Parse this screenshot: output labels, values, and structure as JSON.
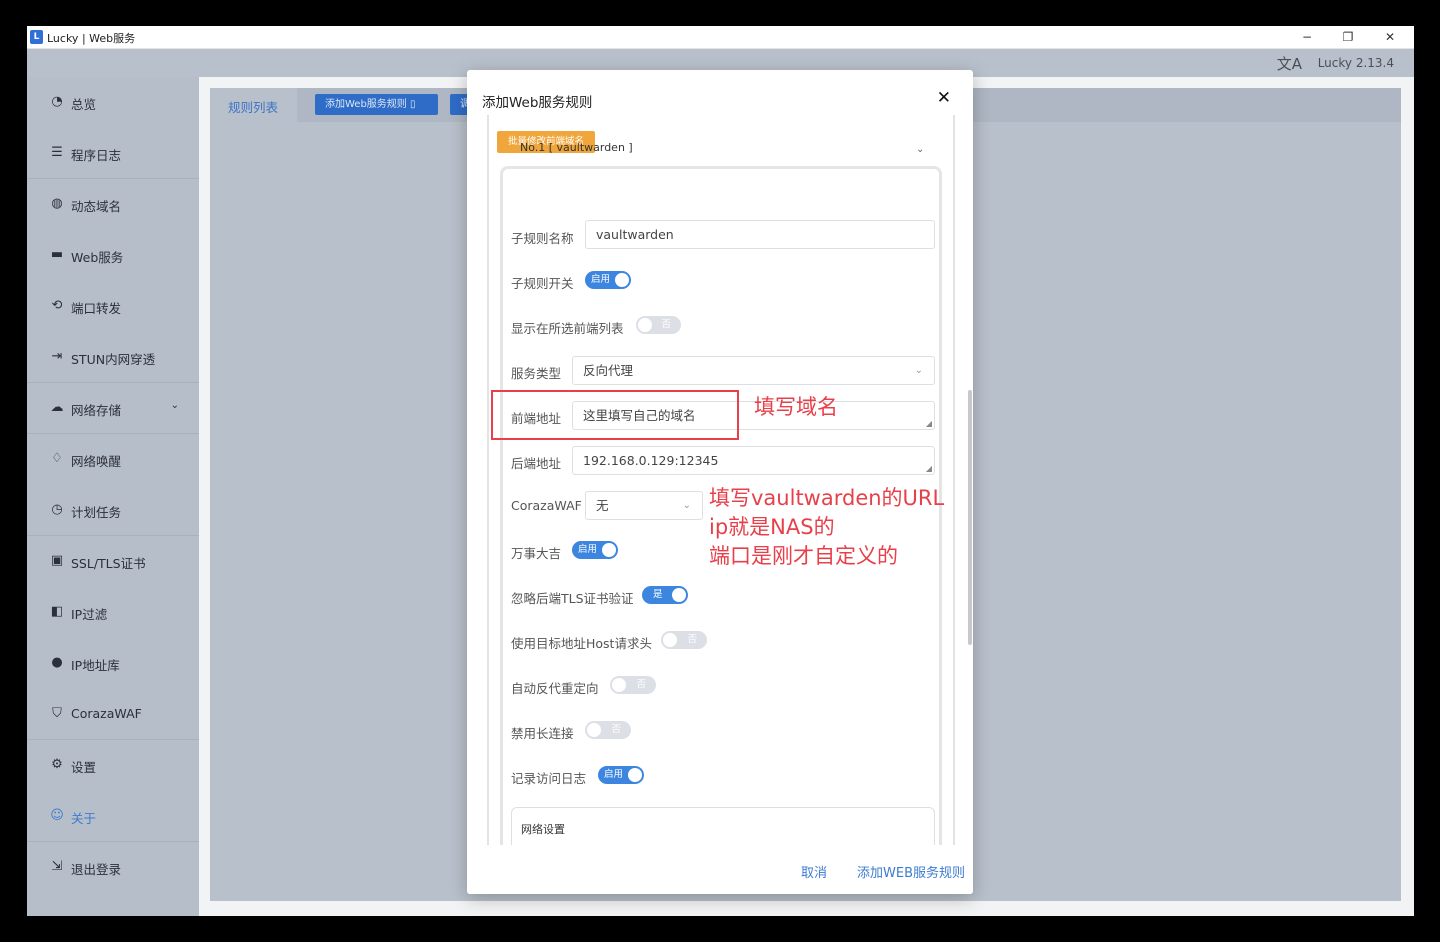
{
  "window": {
    "title": "Lucky | Web服务",
    "minimize": "−",
    "maximize": "❐",
    "close": "✕"
  },
  "topbar": {
    "version": "Lucky 2.13.4"
  },
  "sidebar": {
    "items": [
      {
        "label": "总览",
        "icon": "dashboard-icon"
      },
      {
        "label": "程序日志",
        "icon": "log-icon"
      },
      {
        "label": "动态域名",
        "icon": "ddns-icon"
      },
      {
        "label": "Web服务",
        "icon": "web-icon"
      },
      {
        "label": "端口转发",
        "icon": "port-forward-icon"
      },
      {
        "label": "STUN内网穿透",
        "icon": "stun-icon"
      },
      {
        "label": "网络存储",
        "icon": "cloud-icon"
      },
      {
        "label": "网络唤醒",
        "icon": "bell-icon"
      },
      {
        "label": "计划任务",
        "icon": "clock-icon"
      },
      {
        "label": "SSL/TLS证书",
        "icon": "certificate-icon"
      },
      {
        "label": "IP过滤",
        "icon": "ip-filter-icon"
      },
      {
        "label": "IP地址库",
        "icon": "user-icon"
      },
      {
        "label": "CorazaWAF",
        "icon": "shield-icon"
      },
      {
        "label": "设置",
        "icon": "gear-icon"
      },
      {
        "label": "关于",
        "icon": "about-icon"
      },
      {
        "label": "退出登录",
        "icon": "logout-icon"
      }
    ]
  },
  "main": {
    "tab_rules": "规则列表",
    "add_rule_button": "添加Web服务规则",
    "second_button": "调"
  },
  "dialog": {
    "title": "添加Web服务规则",
    "batch_button": "批量修改前端域名",
    "rule_header": "No.1 [ vaultwarden ]",
    "fields": {
      "subrule_name_label": "子规则名称",
      "subrule_name_value": "vaultwarden",
      "subrule_switch_label": "子规则开关",
      "show_in_list_label": "显示在所选前端列表",
      "service_type_label": "服务类型",
      "service_type_value": "反向代理",
      "frontend_label": "前端地址",
      "frontend_value": "这里填写自己的域名",
      "backend_label": "后端地址",
      "backend_value": "192.168.0.129:12345",
      "waf_label": "CorazaWAF",
      "waf_value": "无",
      "wanshi_label": "万事大吉",
      "ignore_tls_label": "忽略后端TLS证书验证",
      "use_host_label": "使用目标地址Host请求头",
      "auto_redirect_label": "自动反代重定向",
      "disable_keepalive_label": "禁用长连接",
      "access_log_label": "记录访问日志",
      "network_settings": "网络设置"
    },
    "switches": {
      "enabled_text": "启用",
      "no_text": "否",
      "yes_text": "是"
    },
    "footer": {
      "cancel": "取消",
      "submit": "添加WEB服务规则"
    }
  },
  "annotations": {
    "domain_note": "填写域名",
    "backend_note_1": "填写vaultwarden的URL",
    "backend_note_2": "ip就是NAS的",
    "backend_note_3": "端口是刚才自定义的"
  }
}
